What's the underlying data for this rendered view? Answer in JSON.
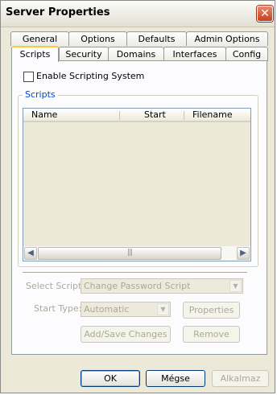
{
  "window": {
    "title": "Server Properties",
    "close_symbol": "✕"
  },
  "tabs": {
    "row1": [
      "General",
      "Options",
      "Defaults",
      "Admin Options"
    ],
    "row2": [
      "Scripts",
      "Security",
      "Domains",
      "Interfaces",
      "Config"
    ],
    "active": "Scripts"
  },
  "scripts_tab": {
    "enable_checkbox": {
      "label": "Enable Scripting System",
      "checked": false
    },
    "group_label": "Scripts",
    "columns": [
      "Name",
      "Start",
      "Filename"
    ],
    "scrollbar": {
      "left_arrow": "◀",
      "right_arrow": "▶",
      "grip": "|||"
    },
    "select_script": {
      "label": "Select Script:",
      "value": "Change Password Script",
      "arrow": "▼"
    },
    "start_type": {
      "label": "Start Type:",
      "value": "Automatic",
      "arrow": "▼"
    },
    "properties_button": "Properties",
    "add_save_button": "Add/Save Changes",
    "remove_button": "Remove"
  },
  "footer": {
    "ok": "OK",
    "cancel": "Mégse",
    "apply": "Alkalmaz"
  }
}
